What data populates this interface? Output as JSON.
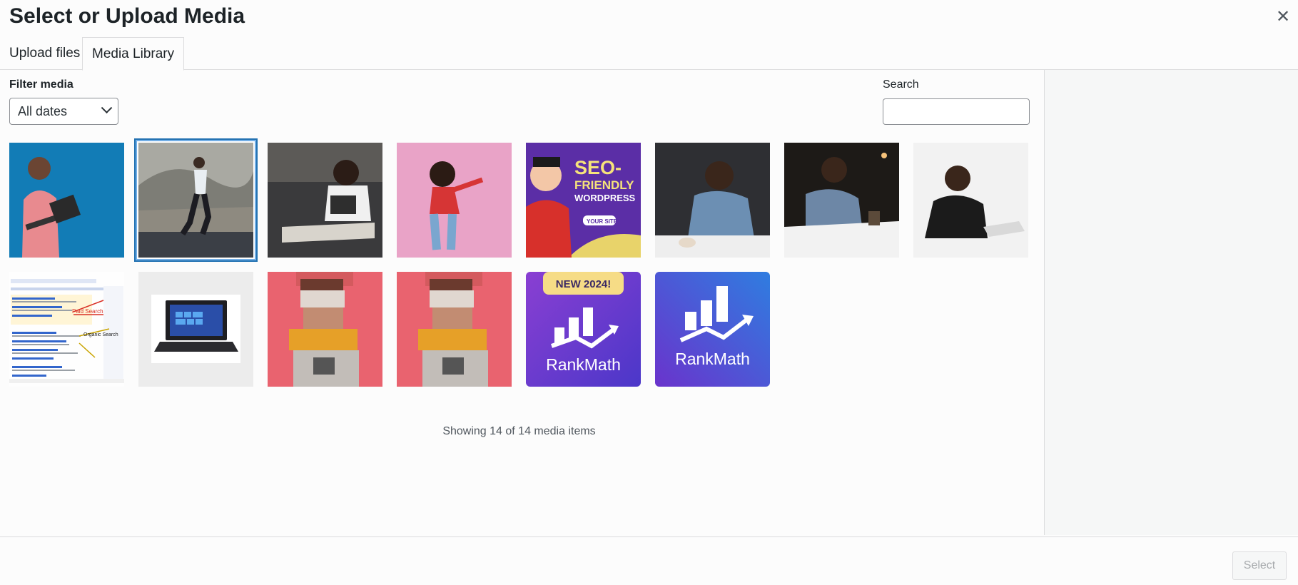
{
  "modal": {
    "title": "Select or Upload Media",
    "close_icon": "close-icon"
  },
  "tabs": [
    {
      "label": "Upload files"
    },
    {
      "label": "Media Library"
    }
  ],
  "filter": {
    "label": "Filter media",
    "selected": "All dates"
  },
  "search": {
    "label": "Search",
    "value": "",
    "placeholder": ""
  },
  "media": {
    "items": [
      {
        "name": "man-with-laptop-blue",
        "selected": false
      },
      {
        "name": "runner-mountain",
        "selected": true
      },
      {
        "name": "boy-tablet-sofa",
        "selected": false
      },
      {
        "name": "woman-dancing-pink",
        "selected": false
      },
      {
        "name": "seo-friendly-wordpress",
        "selected": false,
        "text": [
          "SEO-",
          "FRIENDLY",
          "WORDPRESS",
          "YOUR SITE"
        ]
      },
      {
        "name": "man-at-desk-brick",
        "selected": false
      },
      {
        "name": "man-writing-desk",
        "selected": false
      },
      {
        "name": "man-writing-white",
        "selected": false
      },
      {
        "name": "search-results-screenshot",
        "selected": false,
        "text": [
          "Paid Search",
          "Organic Search"
        ]
      },
      {
        "name": "laptop",
        "selected": false
      },
      {
        "name": "pixelated-person-1",
        "selected": false
      },
      {
        "name": "pixelated-person-2",
        "selected": false
      },
      {
        "name": "rankmath-new-2024",
        "selected": false,
        "text": [
          "NEW 2024!",
          "RankMath"
        ]
      },
      {
        "name": "rankmath",
        "selected": false,
        "text": [
          "RankMath"
        ]
      }
    ],
    "count_text": "Showing 14 of 14 media items"
  },
  "footer": {
    "select_label": "Select"
  },
  "colors": {
    "accent": "#2271b1",
    "focus": "#72aee6",
    "rankmath_purple": "#6b3fd4"
  }
}
